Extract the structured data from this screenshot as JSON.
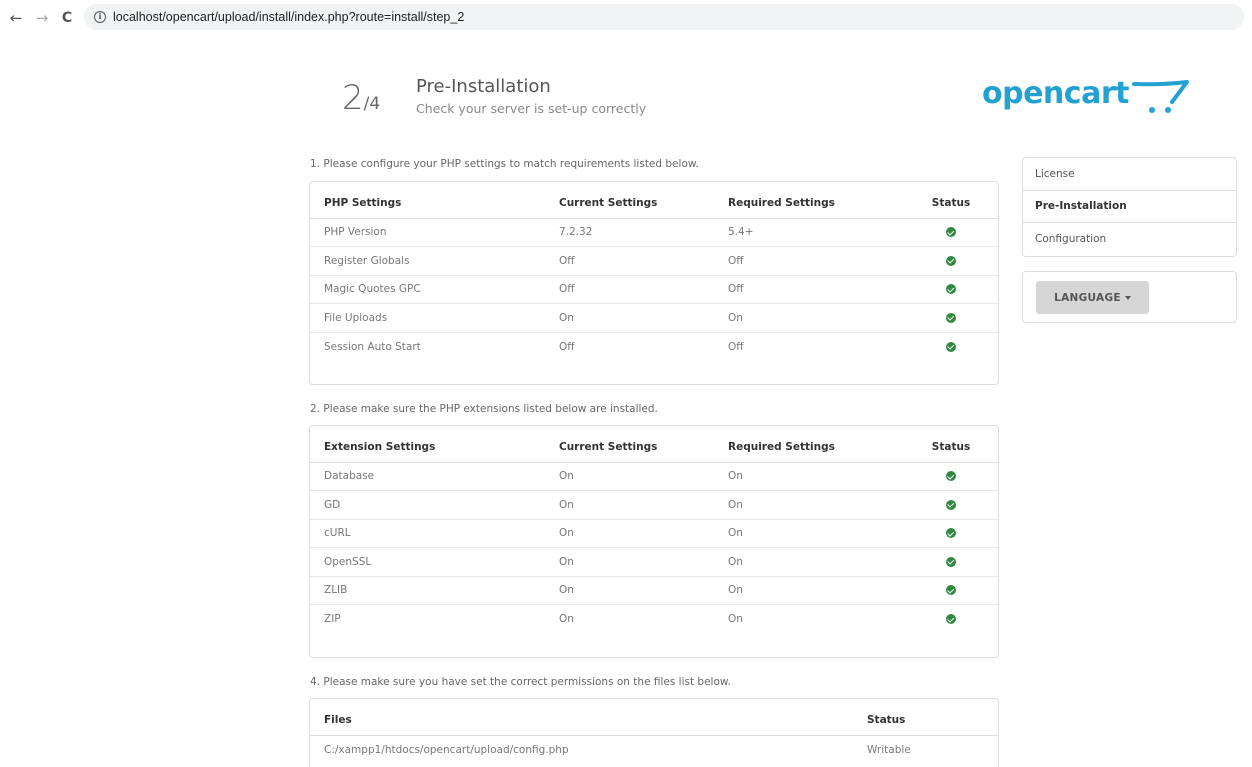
{
  "browser": {
    "url": "localhost/opencart/upload/install/index.php?route=install/step_2",
    "back_icon": "←",
    "forward_icon": "→",
    "reload_icon": "C",
    "info_icon": "i"
  },
  "header": {
    "step_current": "2",
    "step_total": "/4",
    "title": "Pre-Installation",
    "subtitle": "Check your server is set-up correctly",
    "logo_text": "opencart",
    "brand_color": "#23a1d1"
  },
  "php_section": {
    "note": "1. Please configure your PHP settings to match requirements listed below.",
    "headers": [
      "PHP Settings",
      "Current Settings",
      "Required Settings",
      "Status"
    ],
    "rows": [
      [
        "PHP Version",
        "7.2.32",
        "5.4+"
      ],
      [
        "Register Globals",
        "Off",
        "Off"
      ],
      [
        "Magic Quotes GPC",
        "Off",
        "Off"
      ],
      [
        "File Uploads",
        "On",
        "On"
      ],
      [
        "Session Auto Start",
        "Off",
        "Off"
      ]
    ]
  },
  "ext_section": {
    "note": "2. Please make sure the PHP extensions listed below are installed.",
    "headers": [
      "Extension Settings",
      "Current Settings",
      "Required Settings",
      "Status"
    ],
    "rows": [
      [
        "Database",
        "On",
        "On"
      ],
      [
        "GD",
        "On",
        "On"
      ],
      [
        "cURL",
        "On",
        "On"
      ],
      [
        "OpenSSL",
        "On",
        "On"
      ],
      [
        "ZLIB",
        "On",
        "On"
      ],
      [
        "ZIP",
        "On",
        "On"
      ]
    ]
  },
  "files_section": {
    "note": "4. Please make sure you have set the correct permissions on the files list below.",
    "headers": [
      "Files",
      "Status"
    ],
    "rows": [
      [
        "C:/xampp1/htdocs/opencart/upload/config.php",
        "Writable"
      ]
    ]
  },
  "sidebar": {
    "items": [
      "License",
      "Pre-Installation",
      "Configuration"
    ],
    "active_index": 1,
    "language_label": "LANGUAGE"
  },
  "colors": {
    "status_ok": "#2e8a3f",
    "writable": "#3c8d2f"
  }
}
